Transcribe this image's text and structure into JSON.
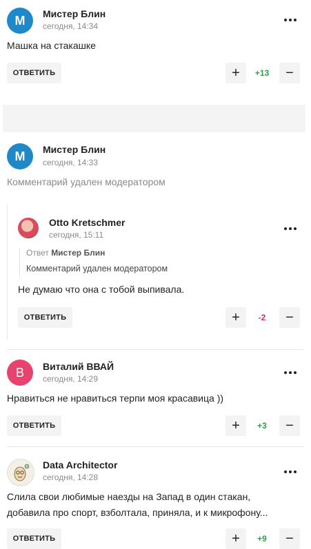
{
  "comments": [
    {
      "author": "Мистер Блин",
      "time": "сегодня, 14:34",
      "avatar_letter": "M",
      "avatar_color": "#1e88c8",
      "text": "Машка на стакашке",
      "reply": "ОТВЕТИТЬ",
      "score": "+13"
    },
    {
      "author": "Мистер Блин",
      "time": "сегодня, 14:33",
      "avatar_letter": "M",
      "avatar_color": "#1e88c8",
      "text": "Комментарий удален модератором"
    },
    {
      "author": "Otto Kretschmer",
      "time": "сегодня, 15:11",
      "avatar_icon": "photo-avatar",
      "quote_prefix": "Ответ",
      "quote_author": "Мистер Блин",
      "quote_text": "Комментарий удален модератором",
      "text": "Не думаю что она с тобой выпивала.",
      "reply": "ОТВЕТИТЬ",
      "score": "-2"
    },
    {
      "author": "Виталий ВВАЙ",
      "time": "сегодня, 14:29",
      "avatar_letter": "B",
      "avatar_color": "#e8436e",
      "text": "Нравиться не нравиться терпи моя красавица ))",
      "reply": "ОТВЕТИТЬ",
      "score": "+3"
    },
    {
      "author": "Data Architector",
      "time": "сегодня, 14:28",
      "avatar_icon": "cartoon-avatar",
      "text_line1": "Слила свои любимые наезды на Запад в один стакан,",
      "text_line2": "добавила про спорт, взболтала, приняла, и к микрофону...",
      "reply": "ОТВЕТИТЬ",
      "score": "+9"
    }
  ],
  "colors": {
    "positive": "#2aa04a",
    "negative": "#e0245e",
    "button_bg": "#f3f3f3"
  },
  "icons": {
    "menu": "more-dots-icon",
    "upvote": "plus-icon",
    "downvote": "minus-icon"
  }
}
